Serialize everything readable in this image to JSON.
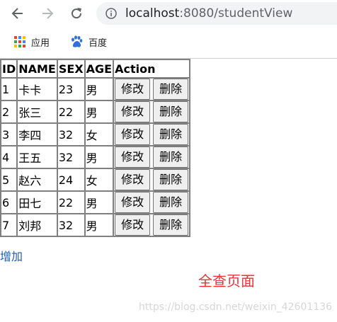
{
  "browser": {
    "url_host": "localhost",
    "url_rest": ":8080/studentView",
    "bookmarks": [
      {
        "label": "应用",
        "icon": "apps-grid-icon"
      },
      {
        "label": "百度",
        "icon": "baidu-paw-icon"
      }
    ]
  },
  "table": {
    "headers": [
      "ID",
      "NAME",
      "SEX",
      "AGE",
      "Action"
    ],
    "rows": [
      {
        "id": "1",
        "name": "卡卡",
        "sex": "23",
        "age": "男"
      },
      {
        "id": "2",
        "name": "张三",
        "sex": "22",
        "age": "男"
      },
      {
        "id": "3",
        "name": "李四",
        "sex": "32",
        "age": "女"
      },
      {
        "id": "4",
        "name": "王五",
        "sex": "32",
        "age": "男"
      },
      {
        "id": "5",
        "name": "赵六",
        "sex": "24",
        "age": "女"
      },
      {
        "id": "6",
        "name": "田七",
        "sex": "22",
        "age": "男"
      },
      {
        "id": "7",
        "name": "刘邦",
        "sex": "32",
        "age": "男"
      }
    ],
    "edit_label": "修改",
    "delete_label": "删除"
  },
  "add_link": "增加",
  "page_heading": "全查页面",
  "watermark": "https://blog.csdn.net/weixin_42601136",
  "colors": {
    "heading": "#e8333a",
    "link": "#1a5fb4"
  }
}
